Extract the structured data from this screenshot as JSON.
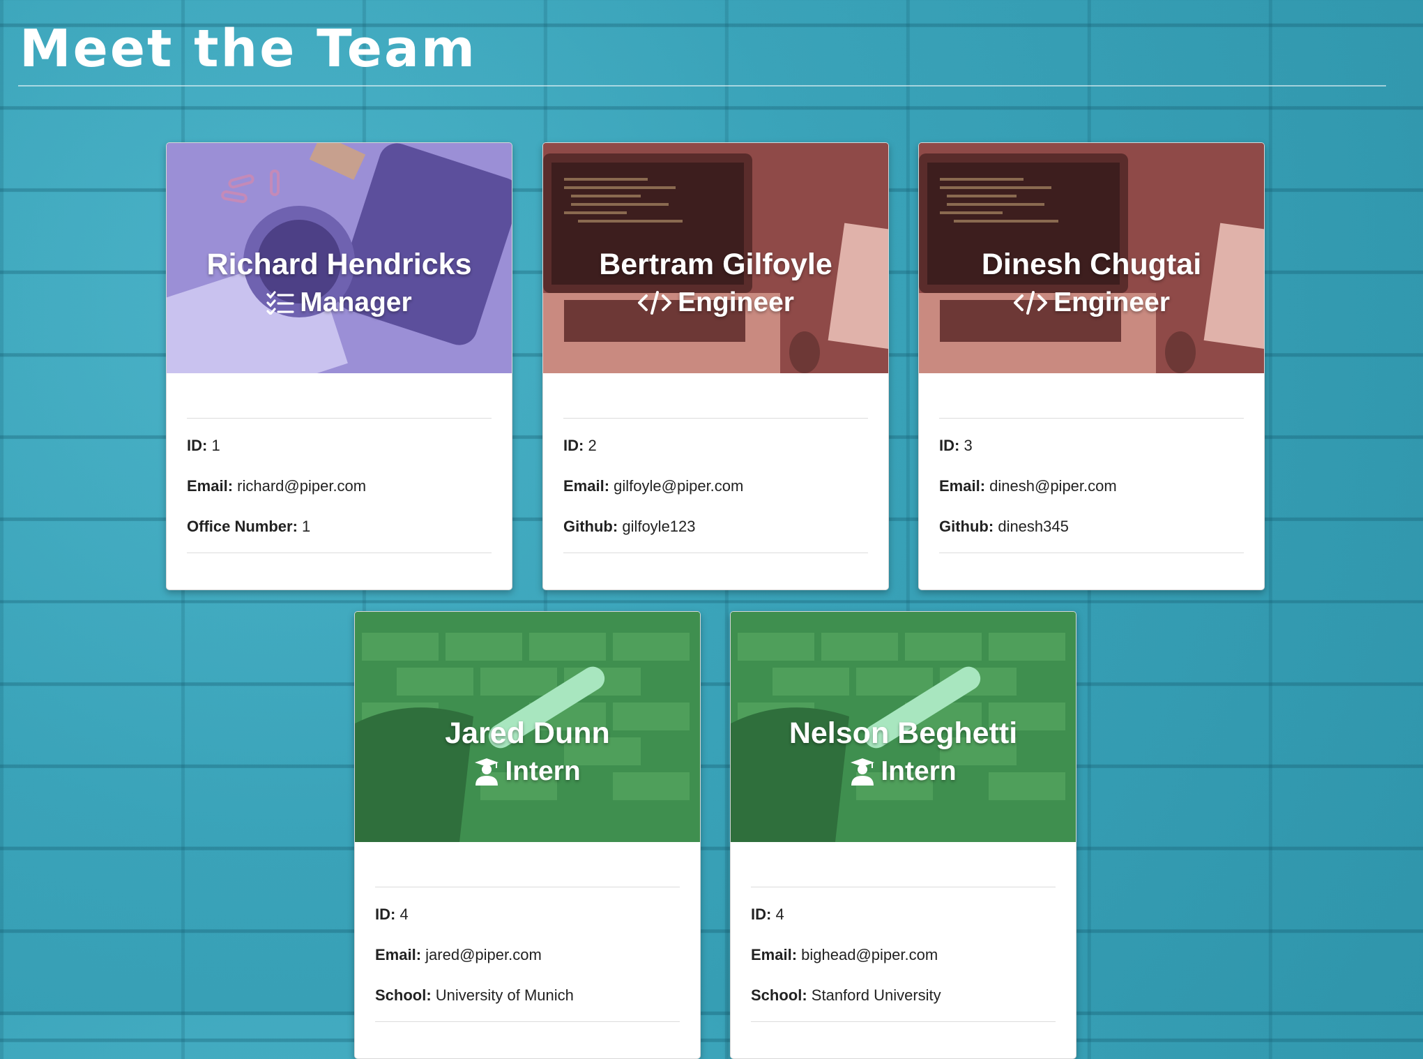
{
  "page": {
    "title": "Meet the Team"
  },
  "labels": {
    "id": "ID:",
    "email": "Email:",
    "office": "Office Number:",
    "github": "Github:",
    "school": "School:"
  },
  "members": [
    {
      "name": "Richard Hendricks",
      "role": "Manager",
      "icon": "checklist-icon",
      "id": "1",
      "email": "richard@piper.com",
      "extra": "1"
    },
    {
      "name": "Bertram Gilfoyle",
      "role": "Engineer",
      "icon": "code-icon",
      "id": "2",
      "email": "gilfoyle@piper.com",
      "extra": "gilfoyle123"
    },
    {
      "name": "Dinesh Chugtai",
      "role": "Engineer",
      "icon": "code-icon",
      "id": "3",
      "email": "dinesh@piper.com",
      "extra": "dinesh345"
    },
    {
      "name": "Jared Dunn",
      "role": "Intern",
      "icon": "graduate-icon",
      "id": "4",
      "email": "jared@piper.com",
      "extra": "University of Munich"
    },
    {
      "name": "Nelson Beghetti",
      "role": "Intern",
      "icon": "graduate-icon",
      "id": "4",
      "email": "bighead@piper.com",
      "extra": "Stanford University"
    }
  ],
  "colors": {
    "background": "#3aa3b9",
    "manager_header": "#9b8fd6",
    "engineer_header": "#8f4a48",
    "intern_header": "#3f8f4f"
  }
}
